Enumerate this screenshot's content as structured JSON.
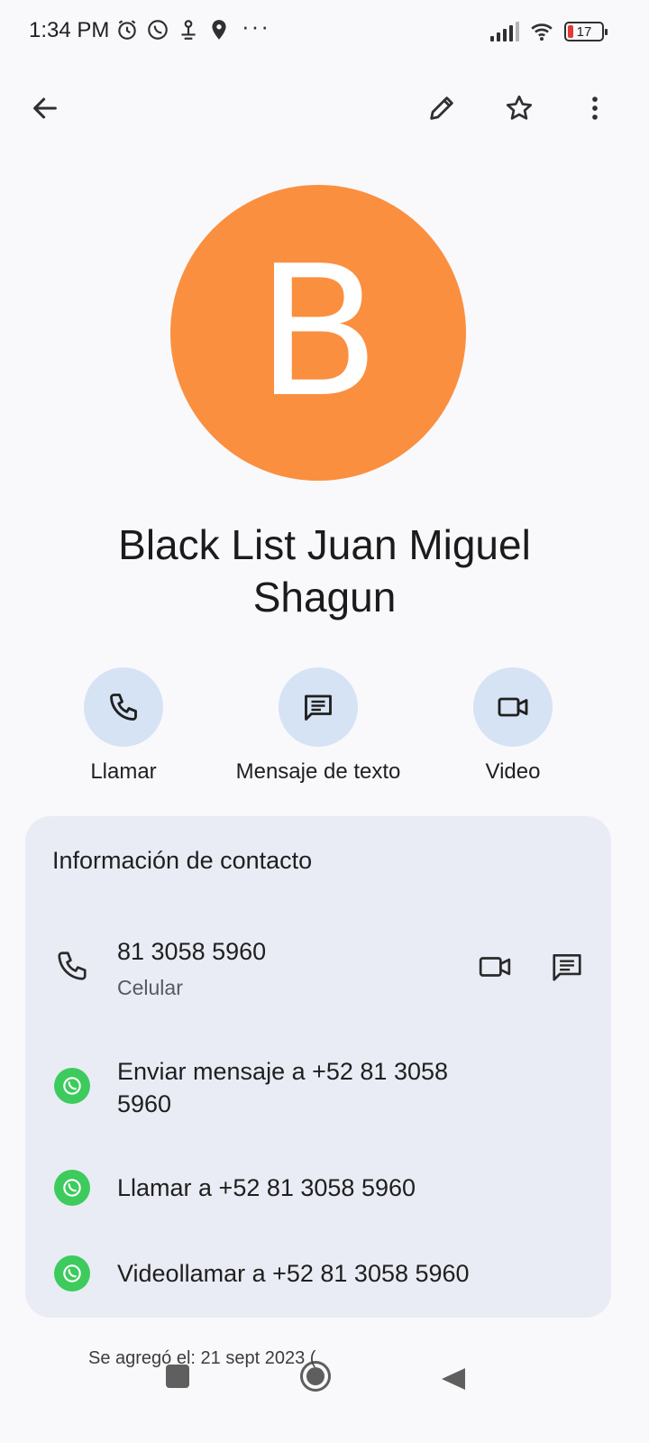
{
  "status_bar": {
    "time": "1:34 PM",
    "battery": "17",
    "more_indicator": "···",
    "icons_left": [
      "alarm-icon",
      "whatsapp-icon",
      "usb-icon",
      "location-icon"
    ],
    "icons_right": [
      "signal-icon",
      "wifi-icon",
      "battery-icon"
    ]
  },
  "app_bar": {
    "icons": [
      "back-arrow-icon",
      "edit-pencil-icon",
      "star-icon",
      "more-vert-icon"
    ]
  },
  "contact": {
    "initial": "B",
    "avatar_color": "#fa8f40",
    "name": "Black List Juan Miguel Shagun"
  },
  "actions": [
    {
      "label": "Llamar",
      "icon": "phone-icon"
    },
    {
      "label": "Mensaje de texto",
      "icon": "message-icon"
    },
    {
      "label": "Video",
      "icon": "videocam-icon"
    }
  ],
  "info": {
    "title": "Información de contacto",
    "phone": {
      "number": "81 3058 5960",
      "type": "Celular"
    },
    "whatsapp_rows": [
      {
        "text": "Enviar mensaje a +52 81 3058 5960"
      },
      {
        "text": "Llamar a +52 81 3058 5960"
      },
      {
        "text": "Videollamar a +52 81 3058 5960"
      }
    ]
  },
  "footer": {
    "added_on": "Se agregó el: 21 sept 2023 ("
  },
  "colors": {
    "accent_bg": "#d6e3f4",
    "card_bg": "#e9ecf4",
    "whatsapp_green": "#3ccb5c"
  }
}
